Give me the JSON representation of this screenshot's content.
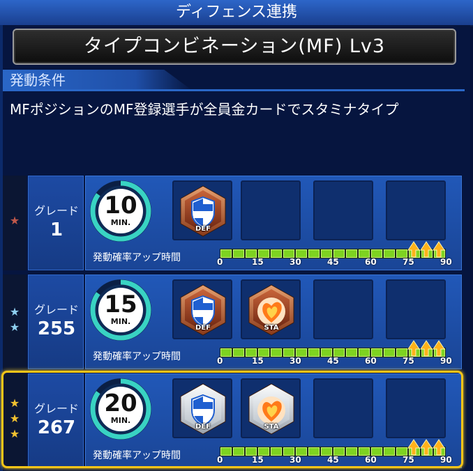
{
  "header": {
    "title": "ディフェンス連携"
  },
  "skill": {
    "name": "タイプコンビネーション(MF) Lv3"
  },
  "condition": {
    "label": "発動条件",
    "text": "MFポジションのMF登録選手が全員金カードでスタミナタイプ"
  },
  "rows": [
    {
      "stars": 1,
      "star_color": "#c0584a",
      "grade_label": "グレード",
      "grade": "1",
      "timer": "10",
      "timer_unit": "MIN.",
      "timer_fraction": 0.85,
      "badges": [
        {
          "icon": "shield-icon",
          "label": "DEF",
          "tier": "bronze"
        }
      ],
      "prob_label": "発動確率アップ時間",
      "selected": false
    },
    {
      "stars": 2,
      "star_color": "#8fd0f0",
      "grade_label": "グレード",
      "grade": "255",
      "timer": "15",
      "timer_unit": "MIN.",
      "timer_fraction": 0.85,
      "badges": [
        {
          "icon": "shield-icon",
          "label": "DEF",
          "tier": "bronze"
        },
        {
          "icon": "heart-flame-icon",
          "label": "STA",
          "tier": "bronze"
        }
      ],
      "prob_label": "発動確率アップ時間",
      "selected": false
    },
    {
      "stars": 3,
      "star_color": "#f2c230",
      "grade_label": "グレード",
      "grade": "267",
      "timer": "20",
      "timer_unit": "MIN.",
      "timer_fraction": 0.85,
      "badges": [
        {
          "icon": "shield-icon",
          "label": "DEF",
          "tier": "silver"
        },
        {
          "icon": "heart-flame-icon",
          "label": "STA",
          "tier": "silver"
        }
      ],
      "prob_label": "発動確率アップ時間",
      "selected": true
    }
  ],
  "gauge": {
    "ticks": [
      "0",
      "15",
      "30",
      "45",
      "60",
      "75",
      "90"
    ],
    "boost_from": 75,
    "max": 90
  }
}
